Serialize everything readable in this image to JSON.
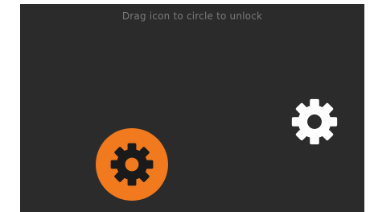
{
  "screen": {
    "instruction": "Drag icon to circle to unlock",
    "background_color": "#2b2b2b"
  },
  "target": {
    "icon": "gear-icon",
    "circle_color": "#f07a1d",
    "icon_color": "#1a1a1a"
  },
  "draggable": {
    "icon": "gear-icon",
    "icon_color": "#ffffff"
  }
}
